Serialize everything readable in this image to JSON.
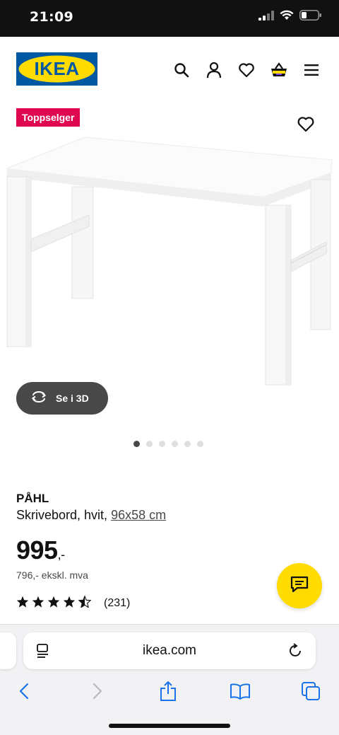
{
  "status": {
    "time": "21:09"
  },
  "header": {
    "logo_text": "IKEA",
    "icons": [
      "search-icon",
      "user-icon",
      "heart-icon",
      "basket-icon",
      "menu-icon"
    ]
  },
  "product": {
    "badge": "Toppselger",
    "view_3d_label": "Se i 3D",
    "image_count": 6,
    "active_image": 1,
    "brand": "PÅHL",
    "description": "Skrivebord, hvit,",
    "size": "96x58 cm",
    "price": "995",
    "price_suffix": ",-",
    "price_ex_vat": "796,- ekskl. mva",
    "rating_stars": 4.5,
    "rating_count": "(231)"
  },
  "browser": {
    "url": "ikea.com",
    "toolbar": [
      "back-icon",
      "forward-icon",
      "share-icon",
      "bookmarks-icon",
      "tabs-icon"
    ]
  },
  "colors": {
    "ikea_blue": "#0058a3",
    "ikea_yellow": "#ffdb00",
    "badge_red": "#e00751",
    "ios_blue": "#1a73e8"
  }
}
